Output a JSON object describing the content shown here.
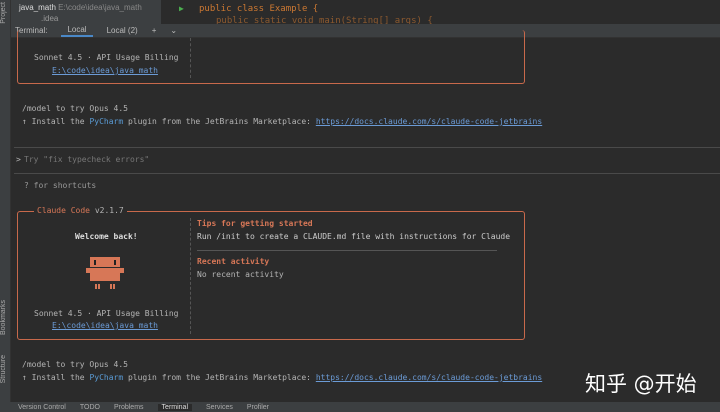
{
  "sidebar": {
    "labels": [
      "Project",
      "Bookmarks",
      "Structure"
    ]
  },
  "tree": {
    "project": "java_math",
    "path": "E:\\code\\idea\\java_math",
    "folder": ".idea"
  },
  "editor": {
    "line1": "public class Example {",
    "line2": "public static void main(String[] args) {"
  },
  "terminal": {
    "label": "Terminal:",
    "tabs": [
      "Local",
      "Local (2)"
    ],
    "add": "+",
    "chevron": "⌄"
  },
  "top_box": {
    "model": "Sonnet 4.5 · API Usage Billing",
    "path": "E:\\code\\idea\\java_math"
  },
  "hint1": {
    "model": "/model to try Opus 4.5",
    "install_pre": "↑ Install the ",
    "pycharm": "PyCharm",
    "install_mid": " plugin from the JetBrains Marketplace: ",
    "url": "https://docs.claude.com/s/claude-code-jetbrains"
  },
  "prompt": {
    "symbol": ">",
    "placeholder": "Try \"fix typecheck errors\"",
    "shortcuts": "? for shortcuts"
  },
  "welcome": {
    "title": "Claude Code",
    "version": "v2.1.7",
    "welcome": "Welcome back!",
    "model": "Sonnet 4.5 · API Usage Billing",
    "path": "E:\\code\\idea\\java_math",
    "tips_title": "Tips for getting started",
    "tips_text": "Run /init to create a CLAUDE.md file with instructions for Claude",
    "recent_title": "Recent activity",
    "recent_text": "No recent activity"
  },
  "statusbar": {
    "items": [
      "Version Control",
      "TODO",
      "Problems",
      "Terminal",
      "Services",
      "Profiler"
    ],
    "active": "Terminal"
  },
  "watermark": "知乎 @开始",
  "colors": {
    "accent": "#d77757",
    "link": "#6b9bd6",
    "background": "#2b2b2b"
  }
}
